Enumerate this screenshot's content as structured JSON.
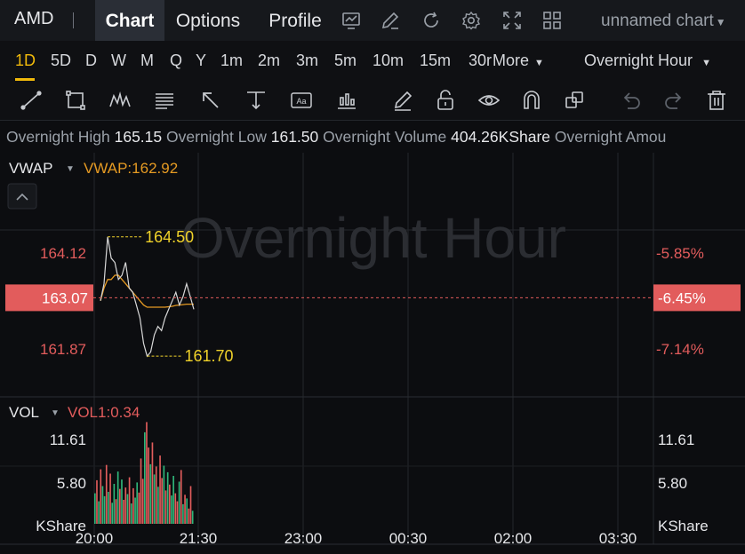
{
  "header": {
    "ticker": "AMD",
    "tabs": [
      {
        "label": "Chart",
        "active": true
      },
      {
        "label": "Options",
        "active": false
      },
      {
        "label": "Profile",
        "active": false
      }
    ],
    "icons": [
      "chart-settings-icon",
      "draw-icon",
      "refresh-icon",
      "gear-icon",
      "fullscreen-icon",
      "layout-grid-icon"
    ],
    "chart_name": "unnamed chart"
  },
  "periods": {
    "items": [
      "1D",
      "5D",
      "D",
      "W",
      "M",
      "Q",
      "Y",
      "1m",
      "2m",
      "3m",
      "5m",
      "10m",
      "15m",
      "30r"
    ],
    "active": "1D",
    "more_label": "More",
    "session": "Overnight Hour"
  },
  "tools": [
    "trend-line-icon",
    "rectangle-icon",
    "pattern-icon",
    "fib-icon",
    "arrow-icon",
    "measure-icon",
    "text-icon",
    "indicator-icon",
    "pencil-icon",
    "lock-icon",
    "eye-icon",
    "magnet-icon",
    "layers-icon",
    "undo-icon",
    "redo-icon",
    "trash-icon"
  ],
  "stats": {
    "high_label": "Overnight High",
    "high_value": "165.15",
    "low_label": "Overnight Low",
    "low_value": "161.50",
    "volume_label": "Overnight Volume",
    "volume_value": "404.26KShare",
    "amount_label": "Overnight Amou"
  },
  "price_panel": {
    "indicator_name": "VWAP",
    "indicator_value": "VWAP:162.92",
    "watermark": "Overnight Hour",
    "left_ticks": [
      "164.12",
      "161.87"
    ],
    "current_price": "163.07",
    "right_ticks": [
      "-5.85%",
      "-7.14%"
    ],
    "current_pct": "-6.45%",
    "high_annotation": "164.50",
    "low_annotation": "161.70"
  },
  "volume_panel": {
    "indicator_name": "VOL",
    "indicator_value": "VOL1:0.34",
    "left_ticks": [
      "11.61",
      "5.80",
      "KShare"
    ],
    "right_ticks": [
      "11.61",
      "5.80",
      "KShare"
    ]
  },
  "x_axis": [
    "20:00",
    "21:30",
    "23:00",
    "00:30",
    "02:00",
    "03:30"
  ],
  "colors": {
    "accent": "#f0b90b",
    "price_tag": "#e25c5c",
    "vwap_line": "#e59a23",
    "price_line": "#d8d8d8",
    "vol_up": "#2fb67a",
    "vol_down": "#e25c5c",
    "annotation": "#f0d22a"
  },
  "chart_data": {
    "type": "line",
    "x_ticks": [
      "20:00",
      "21:30",
      "23:00",
      "00:30",
      "02:00",
      "03:30"
    ],
    "price": {
      "ylim": [
        161.2,
        165.0
      ],
      "series_price": [
        163.0,
        163.4,
        164.5,
        164.0,
        163.9,
        163.5,
        163.6,
        163.9,
        163.3,
        163.2,
        162.9,
        162.6,
        162.0,
        161.7,
        161.8,
        162.2,
        162.4,
        162.3,
        162.6,
        162.8,
        163.0,
        163.2,
        162.9,
        163.1,
        163.4,
        163.1,
        162.8
      ],
      "series_vwap": [
        163.0,
        163.3,
        163.5,
        163.5,
        163.6,
        163.6,
        163.5,
        163.4,
        163.3,
        163.2,
        163.1,
        163.0,
        162.9,
        162.85,
        162.85,
        162.85,
        162.85,
        162.85,
        162.85,
        162.86,
        162.87,
        162.89,
        162.9,
        162.91,
        162.92,
        162.92,
        162.92
      ],
      "high": 164.5,
      "low": 161.7,
      "current": 163.07
    },
    "volume": {
      "ylim": [
        0,
        14
      ],
      "unit": "KShare",
      "values": [
        4.2,
        6.0,
        3.1,
        7.5,
        5.2,
        3.8,
        8.1,
        4.4,
        6.9,
        2.9,
        5.5,
        3.4,
        7.2,
        4.8,
        6.1,
        3.3,
        5.0,
        4.1,
        6.4,
        2.8,
        4.9,
        3.6,
        5.7,
        4.3,
        9.0,
        6.2,
        12.6,
        14.0,
        10.5,
        8.2,
        11.2,
        6.8,
        7.9,
        5.1,
        9.4,
        6.3,
        8.0,
        4.6,
        7.1,
        5.4,
        3.9,
        6.6,
        4.2,
        3.1,
        5.8,
        7.4,
        2.7,
        4.0,
        3.5,
        2.1,
        5.2,
        1.8
      ],
      "direction": [
        "u",
        "d",
        "u",
        "d",
        "u",
        "u",
        "d",
        "u",
        "d",
        "u",
        "u",
        "d",
        "u",
        "d",
        "u",
        "d",
        "d",
        "u",
        "d",
        "u",
        "d",
        "u",
        "u",
        "d",
        "d",
        "d",
        "u",
        "d",
        "d",
        "u",
        "d",
        "u",
        "d",
        "u",
        "d",
        "d",
        "u",
        "d",
        "u",
        "d",
        "u",
        "u",
        "d",
        "d",
        "u",
        "d",
        "u",
        "d",
        "u",
        "d",
        "d",
        "u"
      ]
    }
  }
}
